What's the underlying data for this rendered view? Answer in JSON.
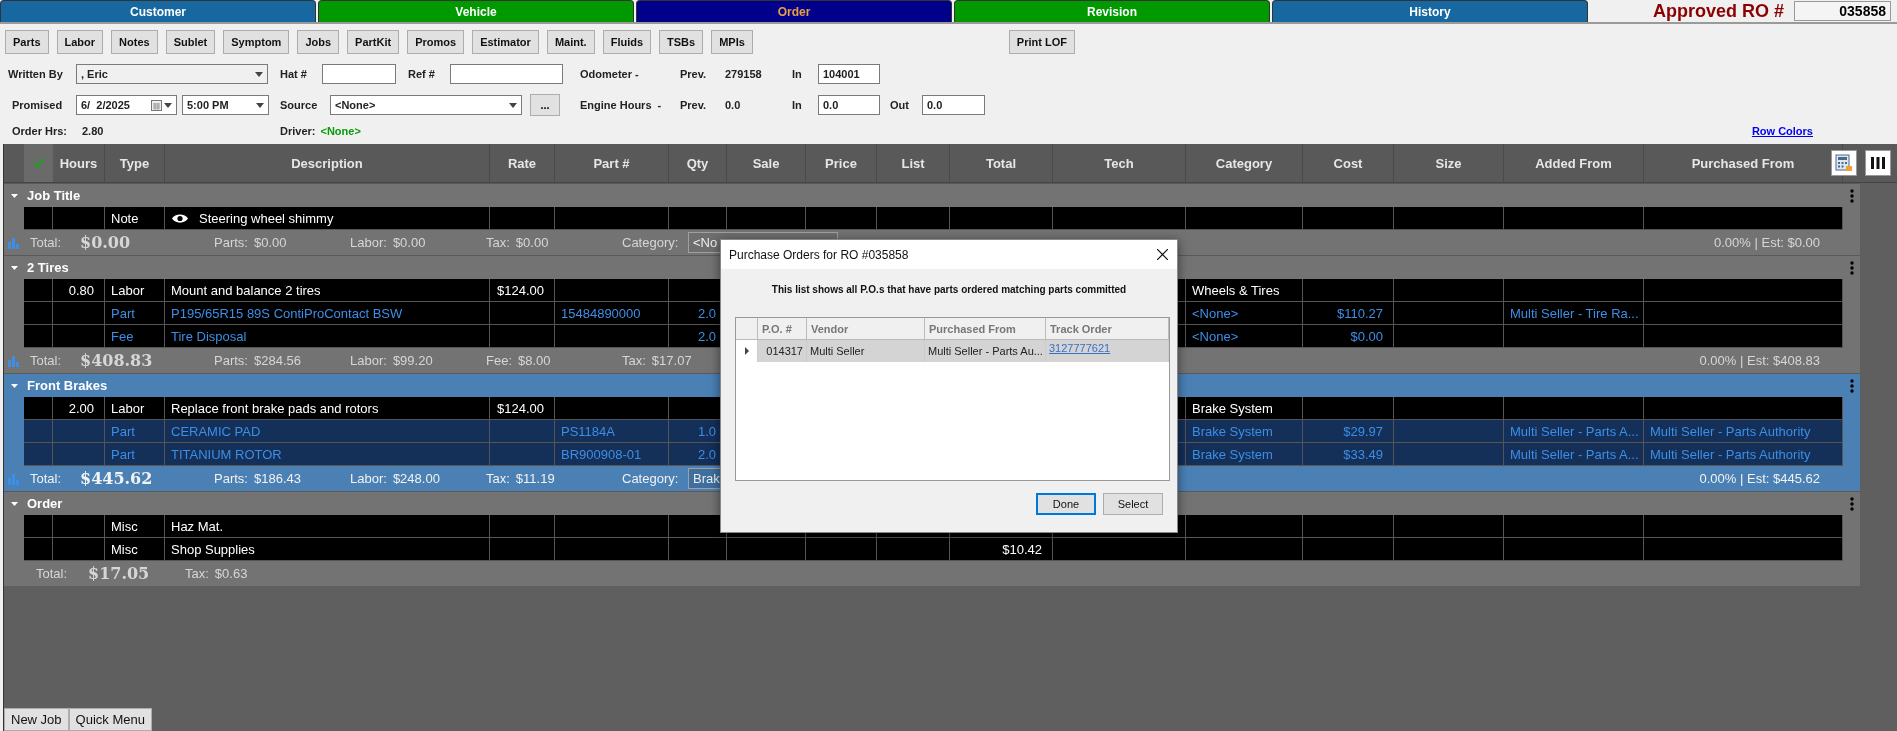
{
  "tabs": [
    {
      "label": "Customer",
      "color": "#1767a0",
      "selected": false
    },
    {
      "label": "Vehicle",
      "color": "#009a00",
      "selected": false
    },
    {
      "label": "Order",
      "color": "#00008b",
      "selected": true
    },
    {
      "label": "Revision",
      "color": "#009a00",
      "selected": false
    },
    {
      "label": "History",
      "color": "#1767a0",
      "selected": false
    }
  ],
  "ro": {
    "label": "Approved RO #",
    "number": "035858"
  },
  "toolbar": [
    "Parts",
    "Labor",
    "Notes",
    "Sublet",
    "Symptom",
    "Jobs",
    "PartKit",
    "Promos",
    "Estimator",
    "Maint.",
    "Fluids",
    "TSBs",
    "MPIs"
  ],
  "print_button": "Print LOF",
  "form": {
    "written_by": {
      "label": "Written By",
      "value": ", Eric"
    },
    "hat": {
      "label": "Hat #"
    },
    "ref": {
      "label": "Ref #"
    },
    "odometer": {
      "label": "Odometer -",
      "prev_label": "Prev.",
      "prev": "279158",
      "in_label": "In",
      "in": "104001"
    },
    "promised": {
      "label": "Promised",
      "date": "6/  2/2025",
      "time": "5:00 PM"
    },
    "source": {
      "label": "Source",
      "value": "<None>",
      "more": "..."
    },
    "engine_hours": {
      "label": "Engine Hours  -",
      "prev_label": "Prev.",
      "prev": "0.0",
      "in_label": "In",
      "in": "0.0",
      "out_label": "Out",
      "out": "0.0"
    },
    "order_hrs": {
      "label": "Order Hrs:",
      "value": "2.80"
    },
    "driver": {
      "label": "Driver:",
      "value": "<None>"
    },
    "row_colors": "Row Colors"
  },
  "table": {
    "columns": [
      "Hours",
      "Type",
      "Description",
      "Rate",
      "Part #",
      "Qty",
      "Sale",
      "Price",
      "List",
      "Total",
      "Tech",
      "Category",
      "Cost",
      "Size",
      "Added From",
      "Purchased From"
    ],
    "groups": [
      {
        "title": "Job Title",
        "selected": false,
        "rows": [
          {
            "kind": "note",
            "highlighted": false,
            "type": "Note",
            "description": "Steering wheel shimmy"
          }
        ],
        "total": {
          "icon": true,
          "label": "Total:",
          "value": "$0.00",
          "items": [
            {
              "label": "Parts:",
              "value": "$0.00"
            },
            {
              "label": "Labor:",
              "value": "$0.00"
            },
            {
              "label": "Tax:",
              "value": "$0.00"
            }
          ],
          "category": {
            "label": "Category:",
            "value": "<No"
          },
          "est": "0.00% | Est: $0.00"
        }
      },
      {
        "title": "2 Tires",
        "selected": false,
        "rows": [
          {
            "kind": "labor",
            "highlighted": false,
            "hours": "0.80",
            "type": "Labor",
            "description": "Mount and balance 2 tires",
            "rate": "$124.00",
            "category": "Wheels & Tires"
          },
          {
            "kind": "part",
            "highlighted": false,
            "type": "Part",
            "description": "P195/65R15 89S ContiProContact BSW",
            "part": "15484890000",
            "qty": "2.0",
            "category": "<None>",
            "cost": "$110.27",
            "added_from": "Multi Seller - Tire Ra..."
          },
          {
            "kind": "fee",
            "highlighted": false,
            "type": "Fee",
            "description": "Tire Disposal",
            "qty": "2.0",
            "category": "<None>",
            "cost": "$0.00"
          }
        ],
        "total": {
          "icon": true,
          "label": "Total:",
          "value": "$408.83",
          "items": [
            {
              "label": "Parts:",
              "value": "$284.56"
            },
            {
              "label": "Labor:",
              "value": "$99.20"
            },
            {
              "label": "Fee:",
              "value": "$8.00"
            },
            {
              "label": "Tax:",
              "value": "$17.07"
            }
          ],
          "est": "0.00% | Est: $408.83"
        }
      },
      {
        "title": "Front Brakes",
        "selected": true,
        "rows": [
          {
            "kind": "labor",
            "highlighted": false,
            "hours": "2.00",
            "type": "Labor",
            "description": "Replace front brake pads and rotors",
            "rate": "$124.00",
            "category": "Brake System"
          },
          {
            "kind": "part",
            "highlighted": true,
            "type": "Part",
            "description": "CERAMIC PAD",
            "part": "PS1184A",
            "qty": "1.0",
            "category": "Brake System",
            "cost": "$29.97",
            "added_from": "Multi Seller - Parts A...",
            "purchased_from": "Multi Seller - Parts Authority"
          },
          {
            "kind": "part",
            "highlighted": true,
            "type": "Part",
            "description": "TITANIUM ROTOR",
            "part": "BR900908-01",
            "qty": "2.0",
            "category": "Brake System",
            "cost": "$33.49",
            "added_from": "Multi Seller - Parts A...",
            "purchased_from": "Multi Seller - Parts Authority"
          }
        ],
        "total": {
          "icon": true,
          "label": "Total:",
          "value": "$445.62",
          "items": [
            {
              "label": "Parts:",
              "value": "$186.43"
            },
            {
              "label": "Labor:",
              "value": "$248.00"
            },
            {
              "label": "Tax:",
              "value": "$11.19"
            }
          ],
          "category": {
            "label": "Category:",
            "value": "Brak"
          },
          "est": "0.00% | Est: $445.62"
        }
      },
      {
        "title": "Order",
        "selected": false,
        "rows": [
          {
            "kind": "misc",
            "highlighted": false,
            "type": "Misc",
            "description": "Haz Mat."
          },
          {
            "kind": "misc",
            "highlighted": false,
            "type": "Misc",
            "description": "Shop Supplies",
            "total": "$10.42"
          }
        ],
        "total": {
          "icon": false,
          "label": "Total:",
          "value": "$17.05",
          "items": [
            {
              "label": "Tax:",
              "value": "$0.63"
            }
          ]
        }
      }
    ]
  },
  "dialog": {
    "title": "Purchase Orders for RO #035858",
    "message": "This list shows all P.O.s that have parts ordered matching parts committed",
    "columns": [
      "P.O. #",
      "Vendor",
      "Purchased From",
      "Track Order"
    ],
    "rows": [
      {
        "selected": true,
        "po": "014317",
        "vendor": "Multi Seller",
        "purchased_from": "Multi Seller - Parts Au...",
        "track_order": "3127777621"
      }
    ],
    "buttons": [
      {
        "label": "Done",
        "default": true
      },
      {
        "label": "Select",
        "default": false
      }
    ]
  },
  "bottom_buttons": [
    "New Job",
    "Quick Menu"
  ]
}
